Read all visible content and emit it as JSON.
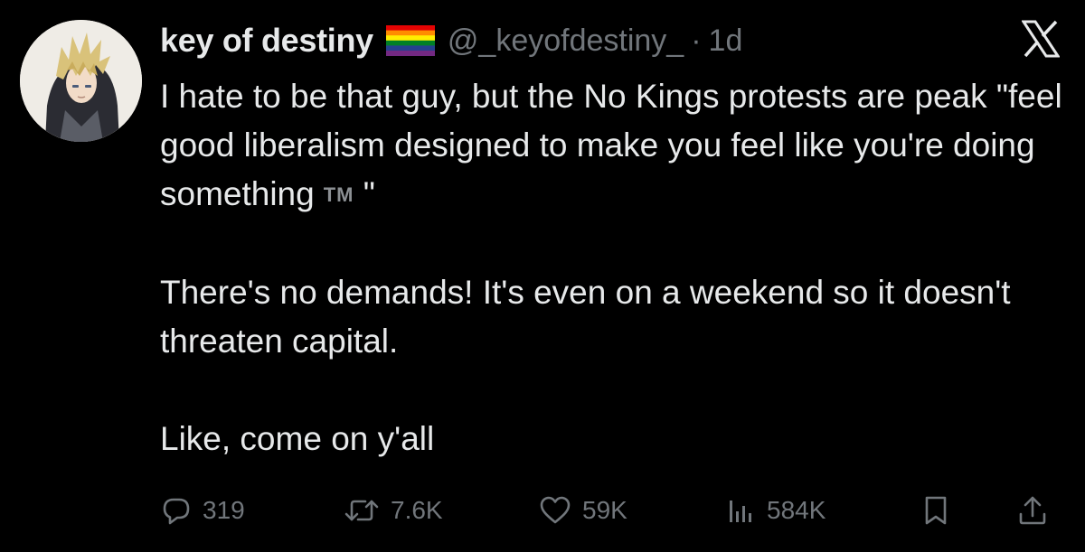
{
  "author": {
    "display_name": "key of destiny",
    "flag_icon": "rainbow-pride-flag-icon",
    "handle": "@_keyofdestiny_",
    "separator": "·",
    "time": "1d"
  },
  "platform_logo": "x-logo-icon",
  "tweet": {
    "paragraphs": [
      "I hate to be that guy, but the No Kings protests are peak \"feel good liberalism designed to make you feel like you're doing something",
      "There's no demands! It's even on a weekend so it doesn't threaten capital.",
      "Like, come on y'all"
    ],
    "tm_mark": "TM",
    "closing_quote": "\""
  },
  "actions": {
    "reply": {
      "icon": "reply-icon",
      "count": "319"
    },
    "retweet": {
      "icon": "retweet-icon",
      "count": "7.6K"
    },
    "like": {
      "icon": "heart-icon",
      "count": "59K"
    },
    "views": {
      "icon": "views-bar-chart-icon",
      "count": "584K"
    },
    "bookmark": {
      "icon": "bookmark-icon"
    },
    "share": {
      "icon": "share-icon"
    }
  },
  "colors": {
    "background": "#000000",
    "primary_text": "#e7e9ea",
    "secondary_text": "#71767b"
  }
}
